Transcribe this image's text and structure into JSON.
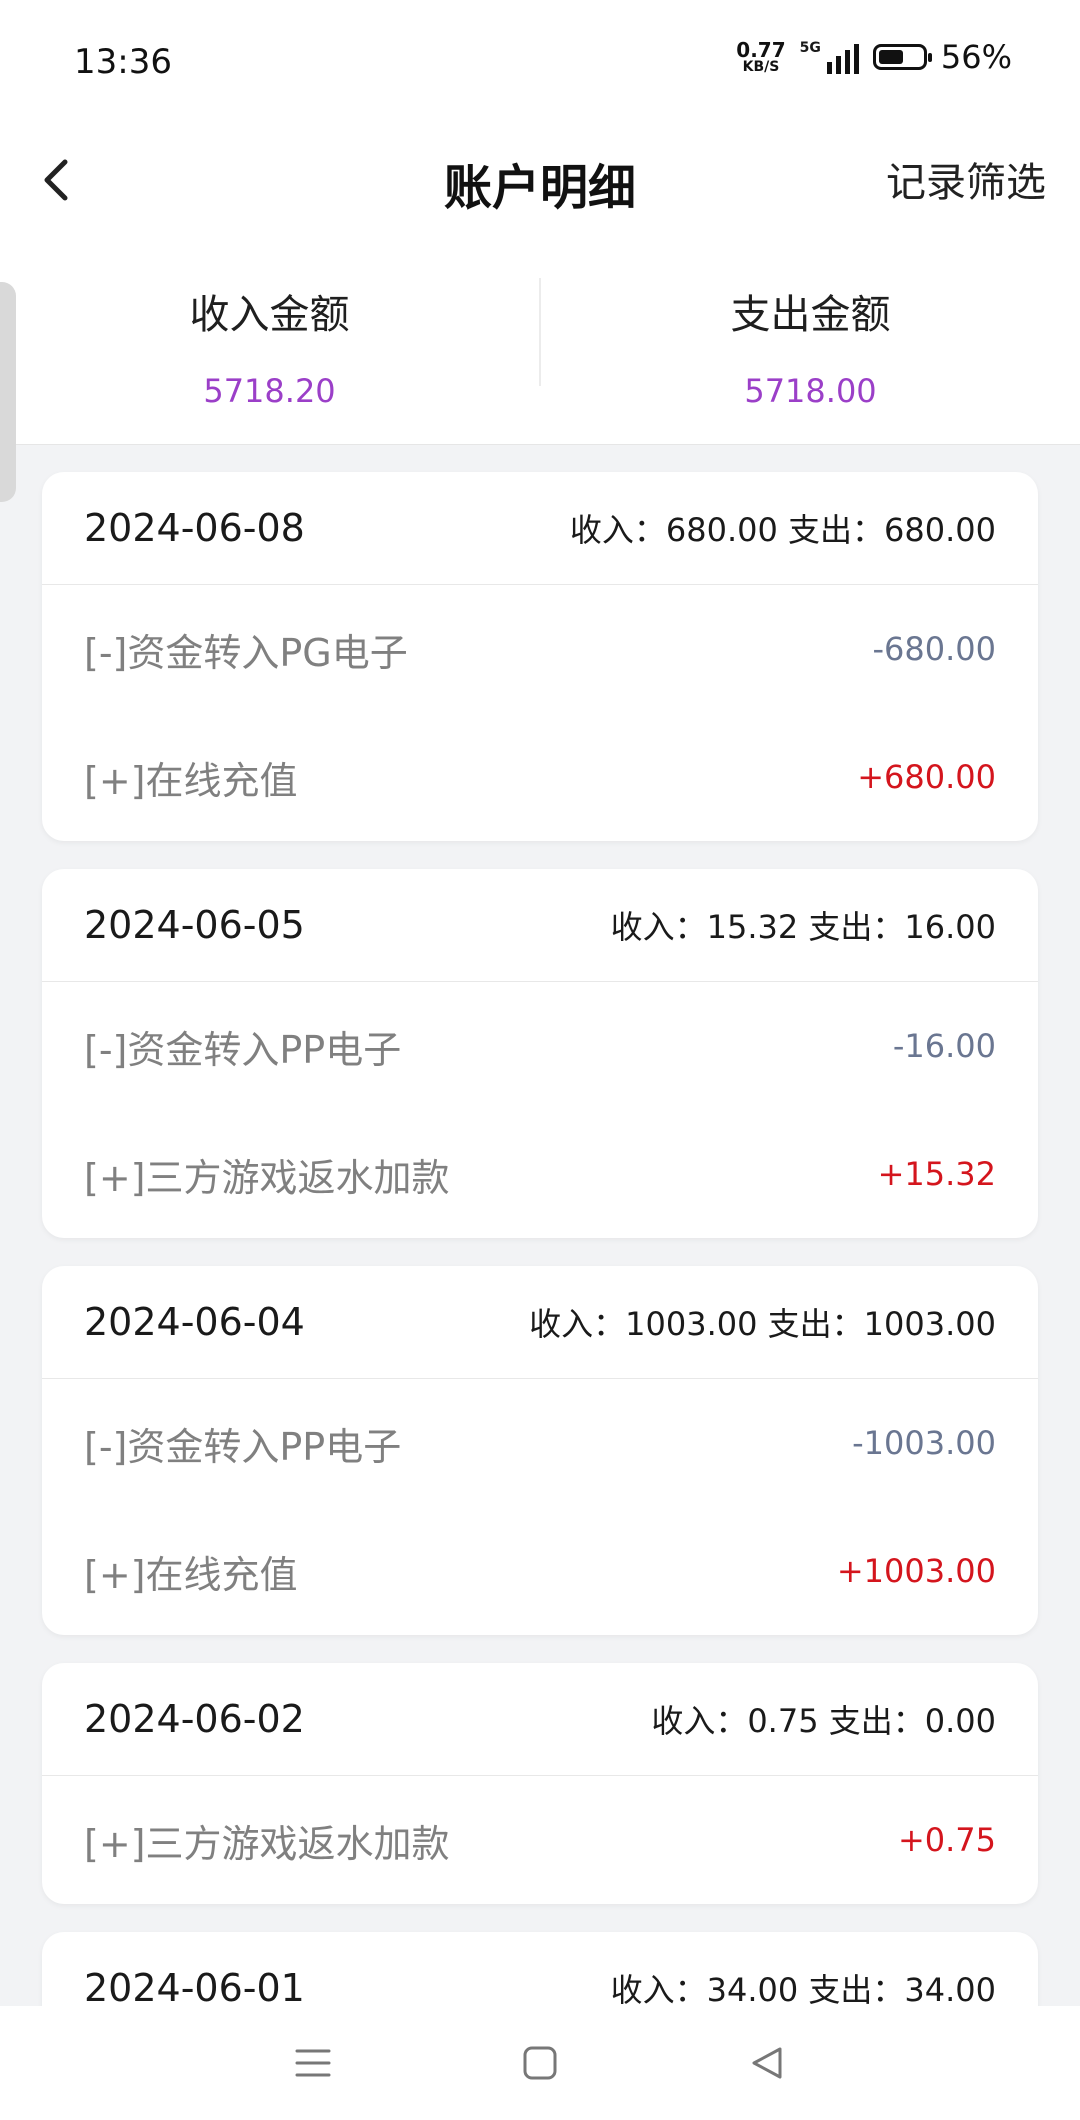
{
  "status_bar": {
    "time": "13:36",
    "net_speed": "0.77",
    "net_unit": "KB/S",
    "network": "5G",
    "battery_percent": "56%",
    "battery_level": 0.56
  },
  "header": {
    "title": "账户明细",
    "filter_label": "记录筛选"
  },
  "summary": {
    "income_label": "收入金额",
    "income_value": "5718.20",
    "expense_label": "支出金额",
    "expense_value": "5718.00"
  },
  "days": [
    {
      "date": "2024-06-08",
      "totals": "收入：680.00 支出：680.00",
      "records": [
        {
          "label": "[-]资金转入PG电子",
          "amount": "-680.00",
          "kind": "neg"
        },
        {
          "label": "[+]在线充值",
          "amount": "+680.00",
          "kind": "pos"
        }
      ]
    },
    {
      "date": "2024-06-05",
      "totals": "收入：15.32 支出：16.00",
      "records": [
        {
          "label": "[-]资金转入PP电子",
          "amount": "-16.00",
          "kind": "neg"
        },
        {
          "label": "[+]三方游戏返水加款",
          "amount": "+15.32",
          "kind": "pos"
        }
      ]
    },
    {
      "date": "2024-06-04",
      "totals": "收入：1003.00 支出：1003.00",
      "records": [
        {
          "label": "[-]资金转入PP电子",
          "amount": "-1003.00",
          "kind": "neg"
        },
        {
          "label": "[+]在线充值",
          "amount": "+1003.00",
          "kind": "pos"
        }
      ]
    },
    {
      "date": "2024-06-02",
      "totals": "收入：0.75 支出：0.00",
      "records": [
        {
          "label": "[+]三方游戏返水加款",
          "amount": "+0.75",
          "kind": "pos"
        }
      ]
    },
    {
      "date": "2024-06-01",
      "totals": "收入：34.00 支出：34.00",
      "records": []
    }
  ],
  "colors": {
    "accent_purple": "#9b3fc8",
    "positive_red": "#d4151d",
    "negative_slate": "#6a7691"
  },
  "icons": {
    "back": "chevron-left-icon",
    "menu": "menu-icon",
    "home": "square-home-icon",
    "nav_back": "triangle-back-icon"
  }
}
